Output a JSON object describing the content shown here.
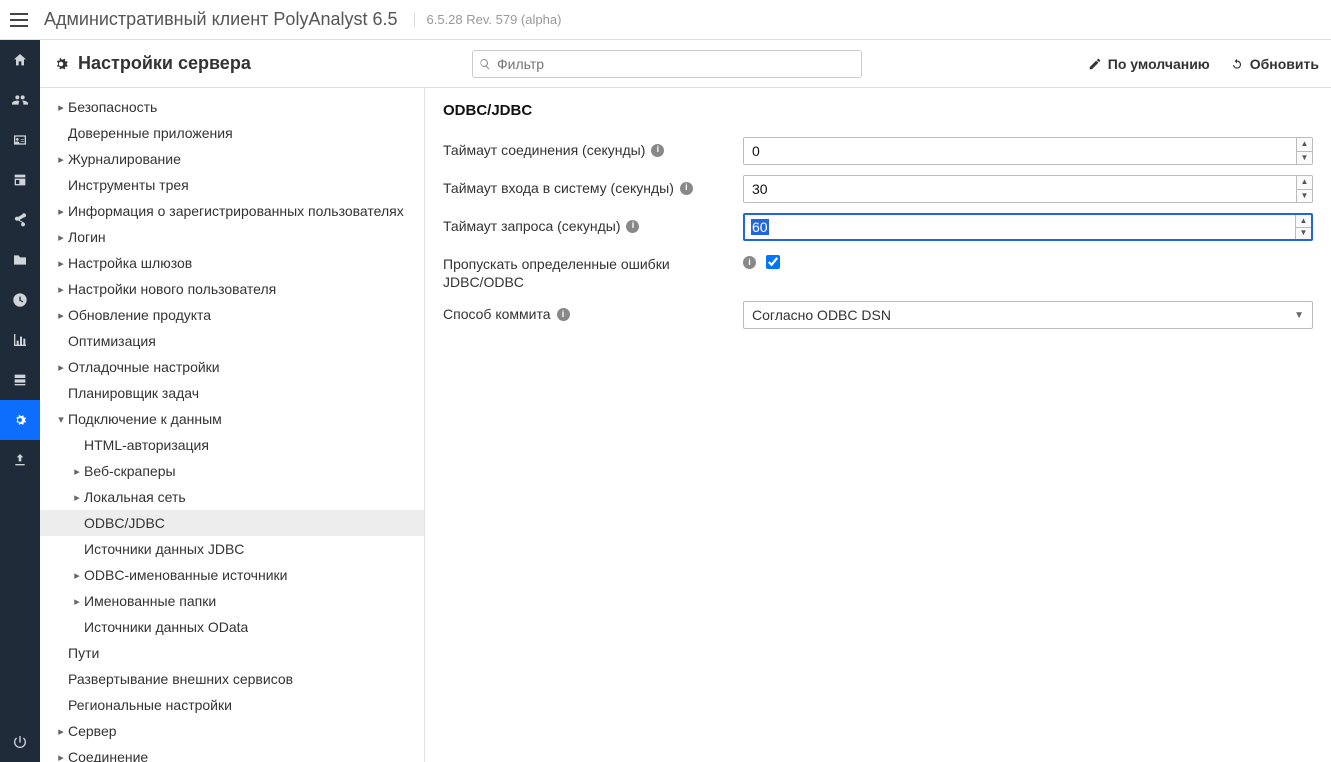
{
  "app": {
    "title": "Административный клиент PolyAnalyst 6.5",
    "version": "6.5.28 Rev. 579 (alpha)"
  },
  "header": {
    "title": "Настройки сервера",
    "filter_placeholder": "Фильтр",
    "default_btn": "По умолчанию",
    "refresh_btn": "Обновить"
  },
  "rail": [
    {
      "name": "home-icon"
    },
    {
      "name": "users-icon"
    },
    {
      "name": "id-icon"
    },
    {
      "name": "card-icon"
    },
    {
      "name": "share-icon"
    },
    {
      "name": "folder-icon"
    },
    {
      "name": "clock-icon"
    },
    {
      "name": "chart-icon"
    },
    {
      "name": "server-icon"
    },
    {
      "name": "gears-icon",
      "active": true
    },
    {
      "name": "upload-icon"
    }
  ],
  "rail_bottom": {
    "name": "power-icon"
  },
  "tree": [
    {
      "label": "Безопасность",
      "indent": 0,
      "toggle": "▸"
    },
    {
      "label": "Доверенные приложения",
      "indent": 0,
      "toggle": ""
    },
    {
      "label": "Журналирование",
      "indent": 0,
      "toggle": "▸"
    },
    {
      "label": "Инструменты трея",
      "indent": 0,
      "toggle": ""
    },
    {
      "label": "Информация о зарегистрированных пользователях",
      "indent": 0,
      "toggle": "▸"
    },
    {
      "label": "Логин",
      "indent": 0,
      "toggle": "▸"
    },
    {
      "label": "Настройка шлюзов",
      "indent": 0,
      "toggle": "▸"
    },
    {
      "label": "Настройки нового пользователя",
      "indent": 0,
      "toggle": "▸"
    },
    {
      "label": "Обновление продукта",
      "indent": 0,
      "toggle": "▸"
    },
    {
      "label": "Оптимизация",
      "indent": 0,
      "toggle": ""
    },
    {
      "label": "Отладочные настройки",
      "indent": 0,
      "toggle": "▸"
    },
    {
      "label": "Планировщик задач",
      "indent": 0,
      "toggle": ""
    },
    {
      "label": "Подключение к данным",
      "indent": 0,
      "toggle": "▾"
    },
    {
      "label": "HTML-авторизация",
      "indent": 1,
      "toggle": ""
    },
    {
      "label": "Веб-скраперы",
      "indent": 1,
      "toggle": "▸"
    },
    {
      "label": "Локальная сеть",
      "indent": 1,
      "toggle": "▸"
    },
    {
      "label": "ODBC/JDBC",
      "indent": 1,
      "toggle": "",
      "selected": true
    },
    {
      "label": "Источники данных JDBC",
      "indent": 1,
      "toggle": ""
    },
    {
      "label": "ODBC-именованные источники",
      "indent": 1,
      "toggle": "▸"
    },
    {
      "label": "Именованные папки",
      "indent": 1,
      "toggle": "▸"
    },
    {
      "label": "Источники данных OData",
      "indent": 1,
      "toggle": ""
    },
    {
      "label": "Пути",
      "indent": 0,
      "toggle": ""
    },
    {
      "label": "Развертывание внешних сервисов",
      "indent": 0,
      "toggle": ""
    },
    {
      "label": "Региональные настройки",
      "indent": 0,
      "toggle": ""
    },
    {
      "label": "Сервер",
      "indent": 0,
      "toggle": "▸"
    },
    {
      "label": "Соединение",
      "indent": 0,
      "toggle": "▸"
    }
  ],
  "detail": {
    "title": "ODBC/JDBC",
    "rows": {
      "conn_timeout": {
        "label": "Таймаут соединения (секунды)",
        "value": "0"
      },
      "login_timeout": {
        "label": "Таймаут входа в систему (секунды)",
        "value": "30"
      },
      "query_timeout": {
        "label": "Таймаут запроса (секунды)",
        "value": "60",
        "focused": true
      },
      "skip_errors": {
        "label": "Пропускать определенные ошибки JDBC/ODBC",
        "checked": true
      },
      "commit_mode": {
        "label": "Способ коммита",
        "value": "Согласно ODBC DSN"
      }
    }
  }
}
